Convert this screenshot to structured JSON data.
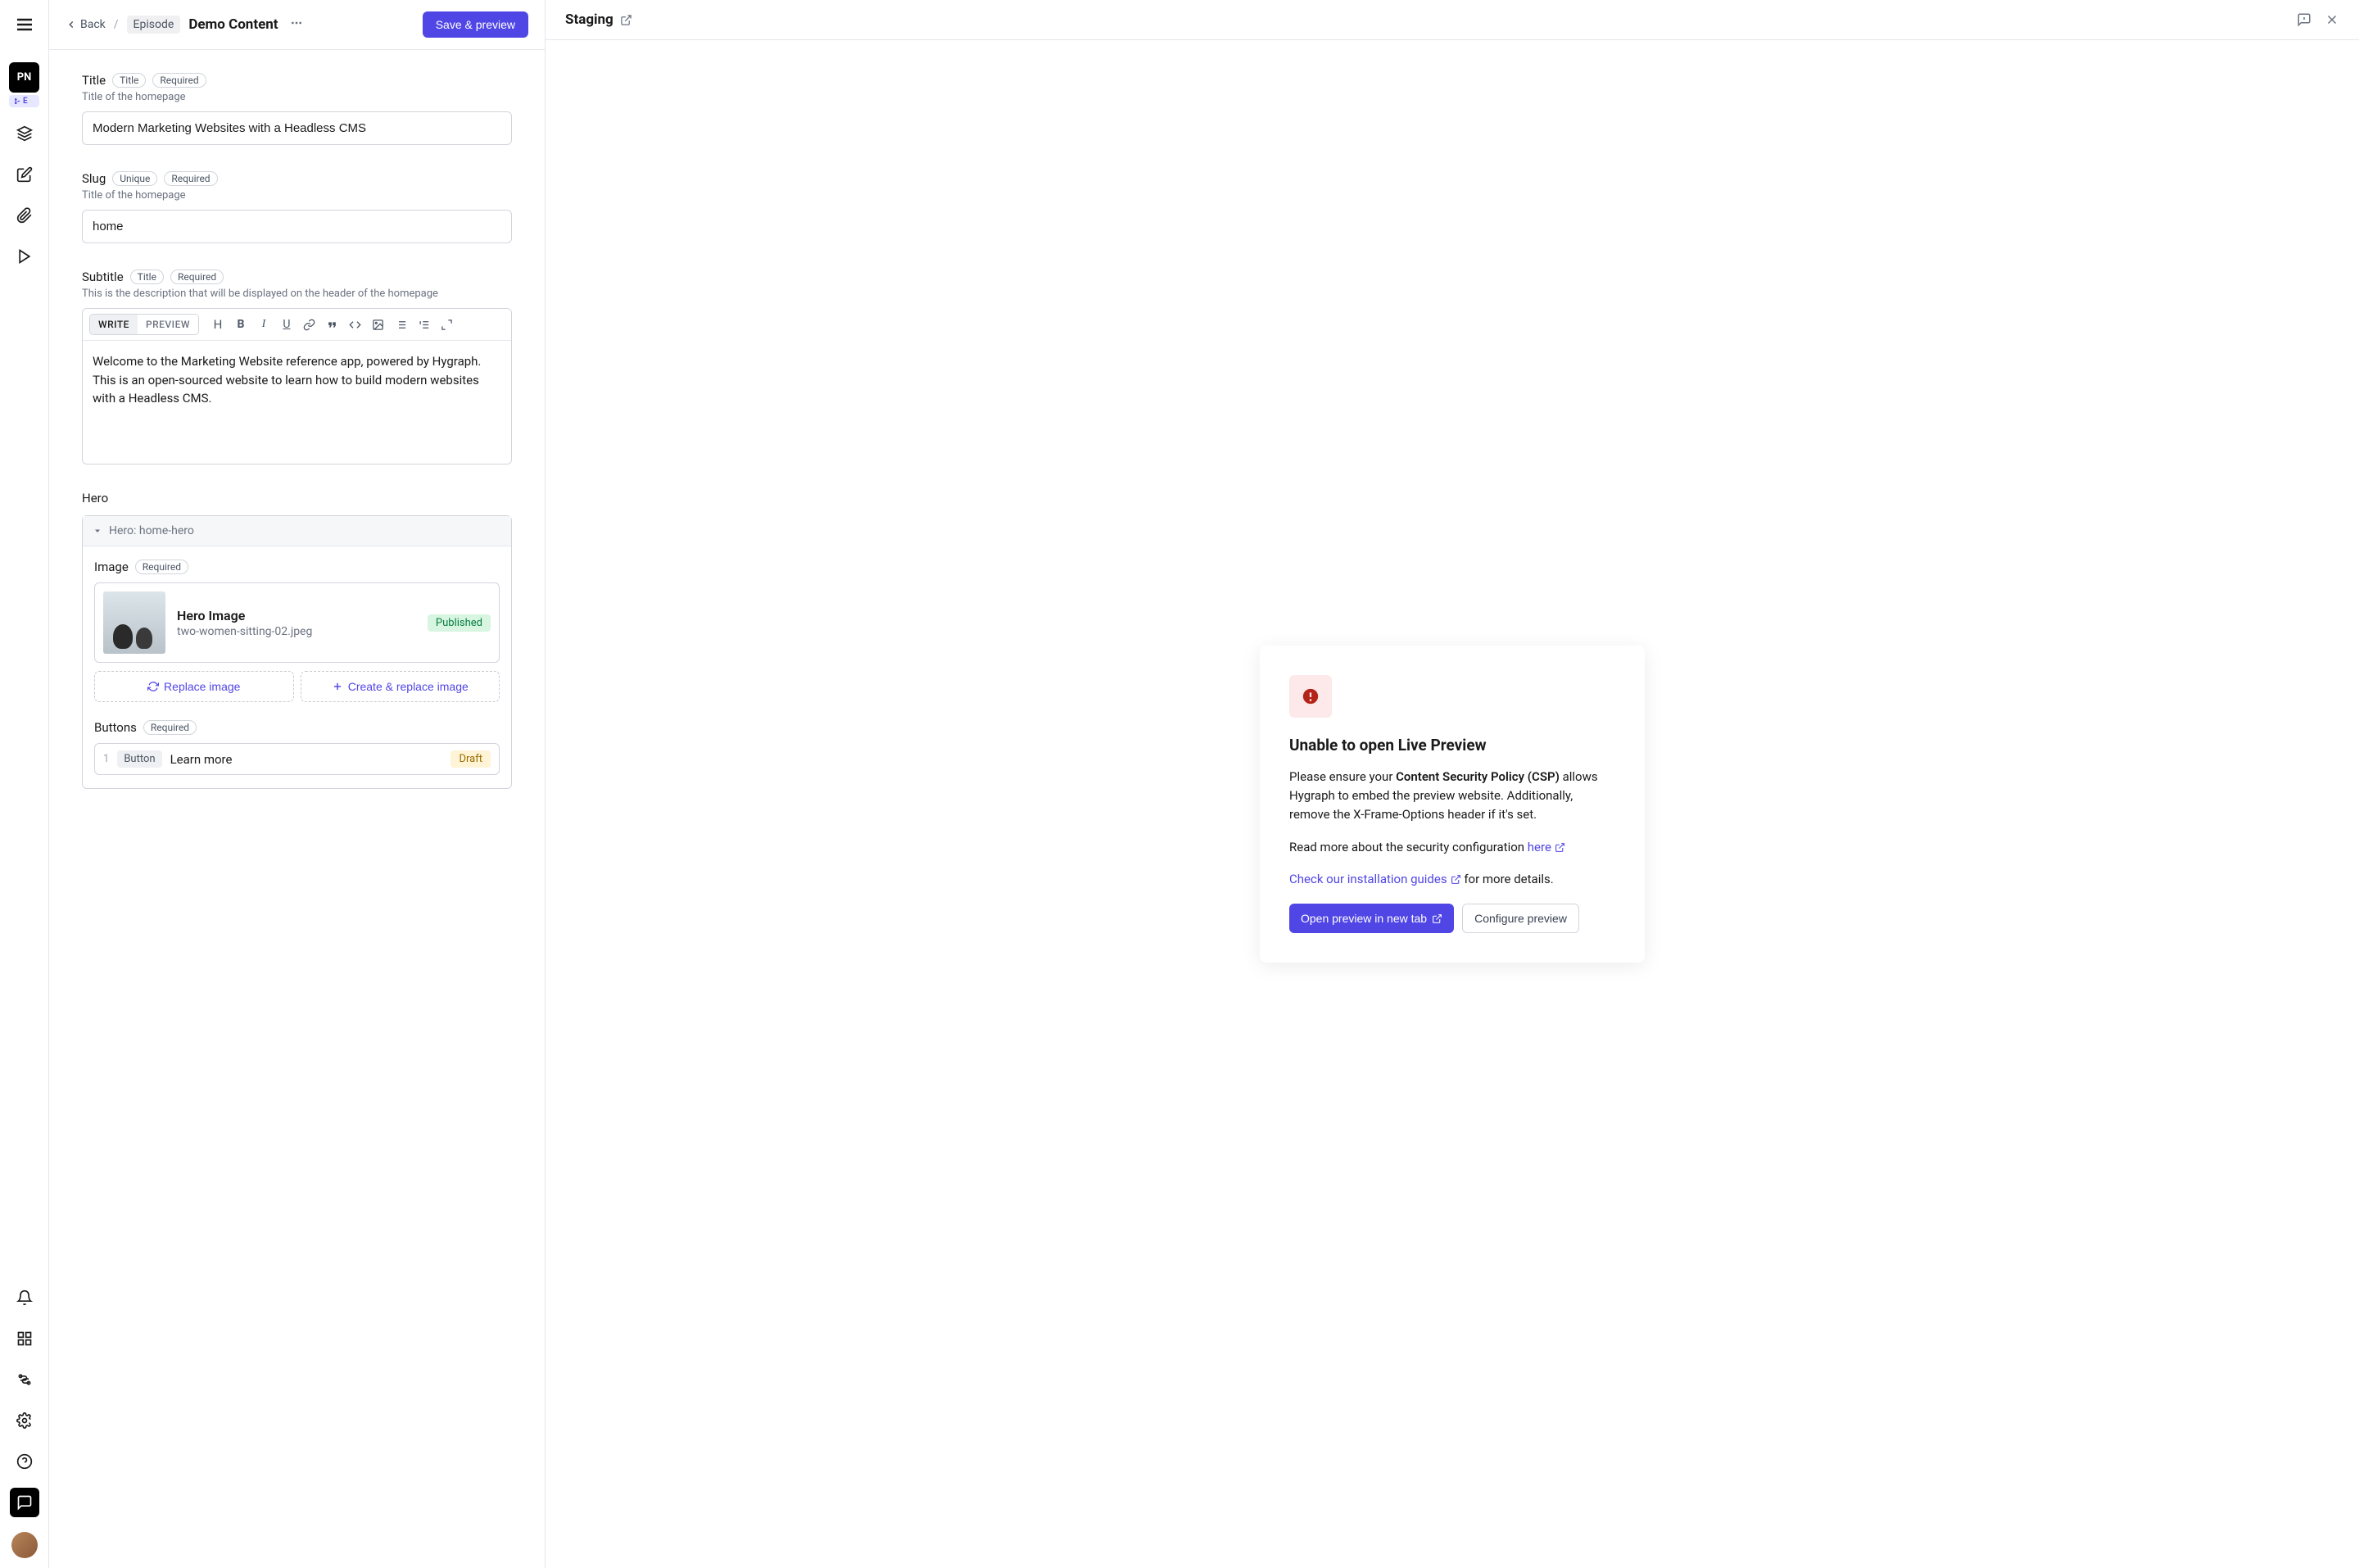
{
  "sidebar": {
    "project_initials": "PN",
    "env_label": "E"
  },
  "header": {
    "back_label": "Back",
    "model_name": "Episode",
    "document_title": "Demo Content",
    "save_label": "Save & preview"
  },
  "fields": {
    "title": {
      "label": "Title",
      "tags": [
        "Title",
        "Required"
      ],
      "description": "Title of the homepage",
      "value": "Modern Marketing Websites with a Headless CMS"
    },
    "slug": {
      "label": "Slug",
      "tags": [
        "Unique",
        "Required"
      ],
      "description": "Title of the homepage",
      "value": "home"
    },
    "subtitle": {
      "label": "Subtitle",
      "tags": [
        "Title",
        "Required"
      ],
      "description": "This is the description that will be displayed on the header of the homepage",
      "write_tab": "WRITE",
      "preview_tab": "PREVIEW",
      "value": "Welcome to the Marketing Website reference app, powered by Hygraph. This is an open-sourced website to learn how to build modern websites with a Headless CMS."
    },
    "hero": {
      "section_label": "Hero",
      "component_title": "Hero: home-hero",
      "image": {
        "label": "Image",
        "tag": "Required",
        "title": "Hero Image",
        "filename": "two-women-sitting-02.jpeg",
        "status": "Published",
        "replace_label": "Replace image",
        "create_label": "Create & replace image"
      },
      "buttons": {
        "label": "Buttons",
        "tag": "Required",
        "items": [
          {
            "index": "1",
            "type": "Button",
            "label": "Learn more",
            "status": "Draft"
          }
        ]
      }
    }
  },
  "preview": {
    "env_title": "Staging",
    "error": {
      "title": "Unable to open Live Preview",
      "p1_pre": "Please ensure your ",
      "p1_bold": "Content Security Policy (CSP)",
      "p1_post": " allows Hygraph to embed the preview website. Additionally, remove the X-Frame-Options header if it's set.",
      "p2_pre": "Read more about the security configuration ",
      "p2_link": "here",
      "p3_link": "Check our installation guides",
      "p3_post": " for more details.",
      "open_tab_label": "Open preview in new tab",
      "configure_label": "Configure preview"
    }
  }
}
